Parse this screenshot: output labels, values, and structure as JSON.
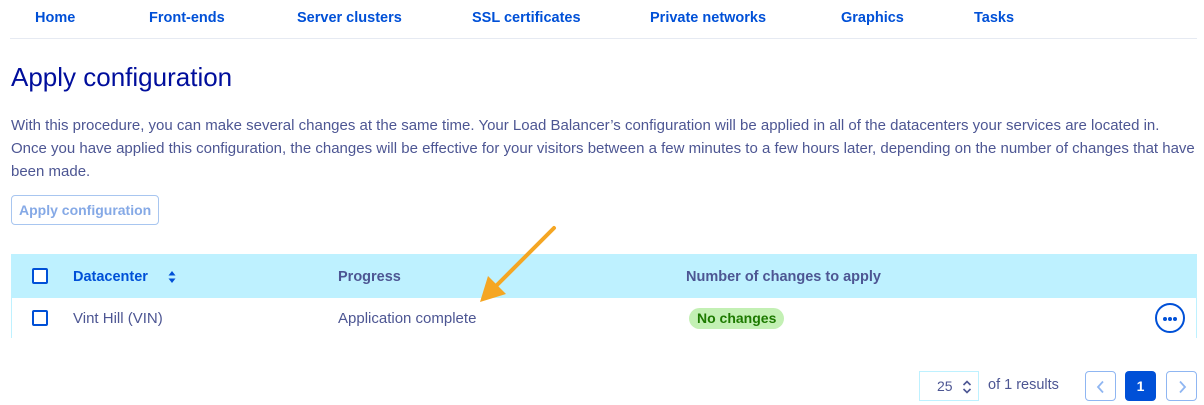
{
  "nav": {
    "items": [
      {
        "label": "Home"
      },
      {
        "label": "Front-ends"
      },
      {
        "label": "Server clusters"
      },
      {
        "label": "SSL certificates"
      },
      {
        "label": "Private networks"
      },
      {
        "label": "Graphics"
      },
      {
        "label": "Tasks"
      }
    ]
  },
  "page": {
    "title": "Apply configuration",
    "description": "With this procedure, you can make several changes at the same time. Your Load Balancer’s configuration will be applied in all of the datacenters your services are located in. Once you have applied this configuration, the changes will be effective for your visitors between a few minutes to a few hours later, depending on the number of changes that have been made.",
    "apply_button": "Apply configuration"
  },
  "table": {
    "columns": {
      "datacenter": "Datacenter",
      "progress": "Progress",
      "changes": "Number of changes to apply"
    },
    "rows": [
      {
        "datacenter": "Vint Hill (VIN)",
        "progress": "Application complete",
        "changes": "No changes"
      }
    ]
  },
  "pagination": {
    "page_size": "25",
    "results_text": "of 1 results",
    "current_page": "1"
  },
  "colors": {
    "accent": "#0050d7",
    "title": "#000e9c",
    "text": "#4d5693",
    "header_bg": "#bef1ff",
    "badge_bg": "#c3f0b4",
    "badge_text": "#1d7a00",
    "annotation_arrow": "#f5a623"
  },
  "icons": {
    "sort": "sort-updown-icon",
    "more": "more-horizontal-icon",
    "prev": "chevron-left-icon",
    "next": "chevron-right-icon",
    "annotation": "annotation-arrow-icon"
  }
}
